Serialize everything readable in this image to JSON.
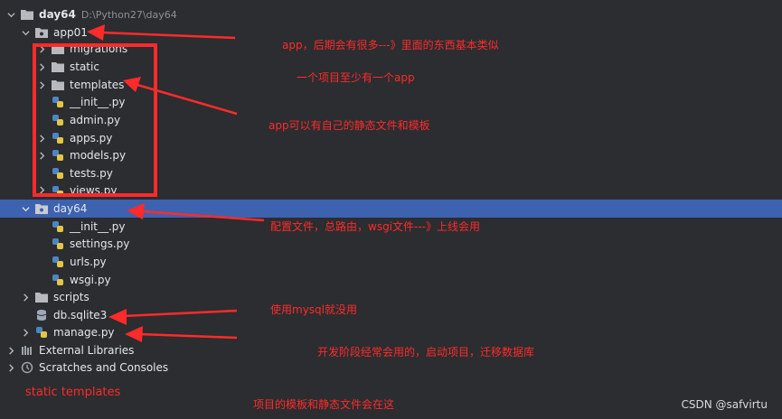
{
  "tree": {
    "root": {
      "name": "day64",
      "path": "D:\\Python27\\day64"
    },
    "items": [
      {
        "label": "app01"
      },
      {
        "label": "migrations"
      },
      {
        "label": "static"
      },
      {
        "label": "templates"
      },
      {
        "label": "__init__.py"
      },
      {
        "label": "admin.py"
      },
      {
        "label": "apps.py"
      },
      {
        "label": "models.py"
      },
      {
        "label": "tests.py"
      },
      {
        "label": "views.py"
      },
      {
        "label": "day64"
      },
      {
        "label": "__init__.py"
      },
      {
        "label": "settings.py"
      },
      {
        "label": "urls.py"
      },
      {
        "label": "wsgi.py"
      },
      {
        "label": "scripts"
      },
      {
        "label": "db.sqlite3"
      },
      {
        "label": "manage.py"
      },
      {
        "label": "External Libraries"
      },
      {
        "label": "Scratches and Consoles"
      }
    ]
  },
  "annotations": {
    "app01_note": "app，后期会有很多---》里面的东西基本类似",
    "at_least_note": "一个项目至少有一个app",
    "app_static_note": "app可以有自己的静态文件和模板",
    "day64_note": "配置文件，总路由，wsgi文件---》上线会用",
    "mysql_note": "使用mysql就没用",
    "manage_note": "开发阶段经常会用的，启动项目，迁移数据库",
    "static_templates": "static  templates",
    "project_note": "项目的模板和静态文件会在这"
  },
  "watermark": "CSDN @safvirtu",
  "colors": {
    "background": "#2b2d30",
    "selected": "#3d62b0",
    "annotation": "#ff2a2a"
  }
}
